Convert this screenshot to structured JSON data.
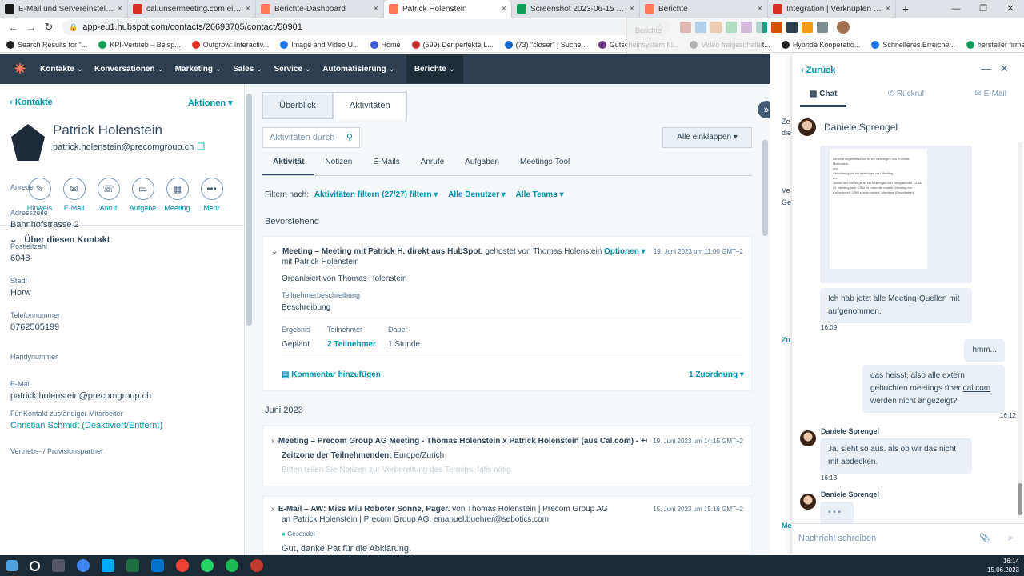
{
  "browser": {
    "tabs": [
      {
        "label": "E-Mail und Servereinstellungen",
        "color": "#1a1a1a"
      },
      {
        "label": "cal.unsermeeting.com einrichten",
        "color": "#d93025"
      },
      {
        "label": "Berichte-Dashboard",
        "color": "#ff7a59"
      },
      {
        "label": "Patrick Holenstein",
        "color": "#ff7a59",
        "active": true
      },
      {
        "label": "Screenshot 2023-06-15 at 16.08",
        "color": "#0f9d58"
      },
      {
        "label": "Berichte",
        "color": "#ff7a59"
      },
      {
        "label": "Integration | Verknüpfen Sie Cal",
        "color": "#d93025"
      }
    ],
    "new_tab": "+",
    "url": "app-eu1.hubspot.com/contacts/26693705/contact/50901",
    "bookmarks": [
      "Search Results for \"...",
      "KPI-Vertrieb – Beisp...",
      "Outgrow: Interactiv...",
      "Image and Video U...",
      "Home",
      "(599) Der perfekte L...",
      "(73) \"closer\" | Suche...",
      "Gutscheinsystem fü...",
      "Video freigeschaltet...",
      "Hybride Kooperatio...",
      "Schnelleres Erreiche...",
      "hersteller firmen -..."
    ],
    "ghost_text": "Berichte"
  },
  "nav": {
    "items": [
      "Kontakte",
      "Konversationen",
      "Marketing",
      "Sales",
      "Service",
      "Automatisierung",
      "Berichte"
    ]
  },
  "contact": {
    "back": "Kontakte",
    "actions": "Aktionen",
    "name": "Patrick Holenstein",
    "email": "patrick.holenstein@precomgroup.ch",
    "quick": [
      "Hinweis",
      "E-Mail",
      "Anruf",
      "Aufgabe",
      "Meeting",
      "Mehr"
    ],
    "about": "Über diesen Kontakt",
    "fields": [
      {
        "label": "Anrede",
        "value": ""
      },
      {
        "label": "Adresszeile",
        "value": "Bahnhofstrasse 2"
      },
      {
        "label": "Postleitzahl",
        "value": "6048"
      },
      {
        "label": "Stadt",
        "value": "Horw"
      },
      {
        "label": "Telefonnummer",
        "value": "0762505199"
      },
      {
        "label": "Handynummer",
        "value": ""
      },
      {
        "label": "E-Mail",
        "value": "patrick.holenstein@precomgroup.ch"
      },
      {
        "label": "Für Kontakt zuständiger Mitarbeiter",
        "value": "Christian Schmidt (Deaktiviert/Entfernt)"
      },
      {
        "label": "Vertriebs- / Provisionspartner",
        "value": ""
      }
    ]
  },
  "activity": {
    "tabs": [
      "Überblick",
      "Aktivitäten"
    ],
    "search_placeholder": "Aktivitäten durch",
    "collapse": "Alle einklappen",
    "subtabs": [
      "Aktivität",
      "Notizen",
      "E-Mails",
      "Anrufe",
      "Aufgaben",
      "Meetings-Tool"
    ],
    "filter_label": "Filtern nach:",
    "filters": [
      "Aktivitäten filtern (27/27) filtern",
      "Alle Benutzer",
      "Alle Teams"
    ],
    "upcoming": "Bevorstehend",
    "month": "Juni 2023",
    "meeting1": {
      "title": "Meeting – Meeting mit Patrick H. direkt aus HubSpot.",
      "hosted": "gehostet von Thomas Holenstein",
      "options": "Optionen",
      "date": "19. Juni 2023 um 11:00 GMT+2",
      "with": "mit Patrick Holenstein",
      "organizer": "Organisiert von Thomas Holenstein",
      "desc_label": "Teilnehmerbeschreibung",
      "desc": "Beschreibung",
      "h_result": "Ergebnis",
      "h_part": "Teilnehmer",
      "h_dur": "Dauer",
      "result": "Geplant",
      "participants": "2 Teilnehmer",
      "duration": "1 Stunde",
      "comment": "Kommentar hinzufügen",
      "assoc": "1 Zuordnung"
    },
    "meeting2": {
      "title": "Meeting – Precom Group AG Meeting - Thomas Holenstein x Patrick Holenstein (aus Cal.com) - +4...",
      "date": "19. Juni 2023 um 14:15 GMT+2",
      "tz_label": "Zeitzone der Teilnehmenden:",
      "tz": "Europe/Zurich",
      "faded": "Bitten teilen Sie Notizen zur Vorbereitung des Termins, falls nötig."
    },
    "email": {
      "title": "E-Mail – AW: Miss Miu Roboter Sonne, Pager.",
      "from": "von Thomas Holenstein | Precom Group AG",
      "date": "15. Juni 2023 um 15:16 GMT+2",
      "to": "an Patrick Holenstein | Precom Group AG, emanuel.buehrer@sebotics.com",
      "status": "Gesendet",
      "body": "Gut, danke Pat für die Abklärung."
    }
  },
  "right_fragments": [
    "Ze",
    "die",
    "Ve",
    "Ge",
    "Zu",
    "Me"
  ],
  "chat": {
    "back": "Zurück",
    "tabs": [
      "Chat",
      "Rückruf",
      "E-Mail"
    ],
    "agent": "Daniele Sprengel",
    "messages": [
      {
        "text": "Ich hab jetzt alle Meeting-Quellen mit aufgenommen.",
        "time": "16:09"
      },
      {
        "text": "hmm..."
      },
      {
        "text": "das heisst, also alle extern gebuchten meetings über",
        "link": "cal.com",
        "text2": "werden nicht angezeigt?",
        "time": "16:12"
      },
      {
        "text": "Ja, sieht so aus. als ob wir das nicht mit abdecken.",
        "time": "16:13"
      }
    ],
    "typing": "• • •",
    "input_placeholder": "Nachricht schreiben"
  },
  "taskbar": {
    "time": "16:14",
    "date": "15.06.2023"
  }
}
